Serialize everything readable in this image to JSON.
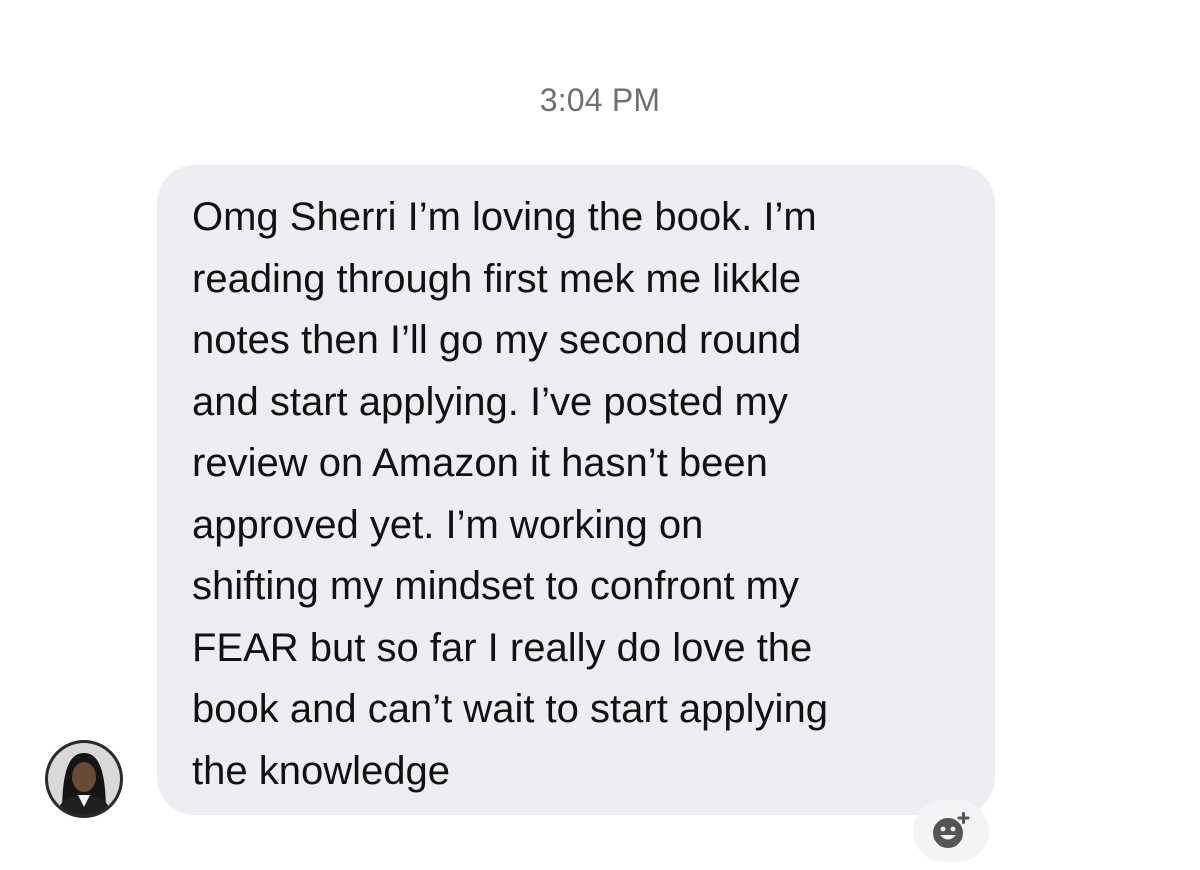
{
  "conversation": {
    "timestamp": "3:04 PM",
    "message": {
      "text": "Omg Sherri I’m loving the book. I’m\nreading through first mek me likkle\nnotes then I’ll go my second round\nand start applying. I’ve posted my\nreview on Amazon it hasn’t been\napproved yet. I’m working on\nshifting my mindset to confront my\nFEAR but so far I really do love the\nbook and can’t wait to start applying\nthe knowledge",
      "bubble_color": "#eeeef2",
      "text_color": "#111111"
    },
    "sender_avatar_icon": "avatar-photo",
    "reaction_button_icon": "add-reaction-icon"
  }
}
